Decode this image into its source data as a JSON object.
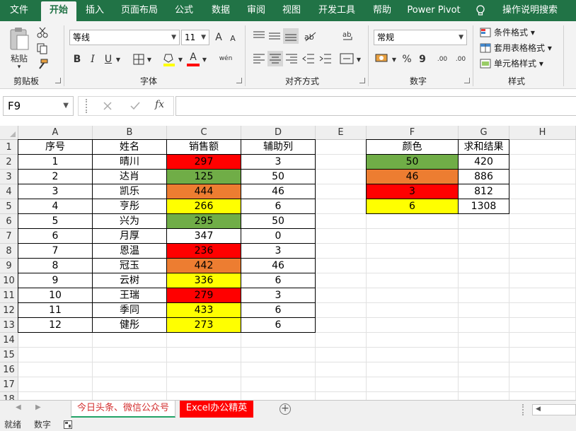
{
  "tabs": [
    "文件",
    "开始",
    "插入",
    "页面布局",
    "公式",
    "数据",
    "审阅",
    "视图",
    "开发工具",
    "帮助",
    "Power Pivot",
    "操作说明搜索"
  ],
  "active_tab": "开始",
  "ribbon": {
    "clipboard": {
      "paste_label": "粘贴",
      "group_label": "剪贴板"
    },
    "font": {
      "font_name": "等线",
      "font_size": "11",
      "increase_label": "A",
      "decrease_label": "A",
      "wen_label": "wén",
      "group_label": "字体"
    },
    "alignment": {
      "group_label": "对齐方式"
    },
    "number": {
      "format": "常规",
      "percent": "%",
      "comma": "9",
      "inc_dec": ".00",
      "group_label": "数字"
    },
    "styles": {
      "conditional": "条件格式",
      "table": "套用表格格式",
      "cell": "单元格样式",
      "group_label": "样式"
    }
  },
  "formula_bar": {
    "name_box": "F9",
    "fx": "fx",
    "content": ""
  },
  "columns": [
    "A",
    "B",
    "C",
    "D",
    "E",
    "F",
    "G",
    "H"
  ],
  "rows": [
    "1",
    "2",
    "3",
    "4",
    "5",
    "6",
    "7",
    "8",
    "9",
    "10",
    "11",
    "12",
    "13",
    "14",
    "15",
    "16",
    "17",
    "18"
  ],
  "table1": {
    "headers": [
      "序号",
      "姓名",
      "销售额",
      "辅助列"
    ],
    "rows": [
      [
        "1",
        "晴川",
        "297",
        "3"
      ],
      [
        "2",
        "达肖",
        "125",
        "50"
      ],
      [
        "3",
        "凯乐",
        "444",
        "46"
      ],
      [
        "4",
        "亨彤",
        "266",
        "6"
      ],
      [
        "5",
        "兴为",
        "295",
        "50"
      ],
      [
        "6",
        "月厚",
        "347",
        "0"
      ],
      [
        "7",
        "恩温",
        "236",
        "3"
      ],
      [
        "8",
        "冠玉",
        "442",
        "46"
      ],
      [
        "9",
        "云树",
        "336",
        "6"
      ],
      [
        "10",
        "王瑞",
        "279",
        "3"
      ],
      [
        "11",
        "季同",
        "433",
        "6"
      ],
      [
        "12",
        "健彤",
        "273",
        "6"
      ]
    ],
    "sales_colors": [
      "#ff0000",
      "#70ad47",
      "#ed7d31",
      "#ffff00",
      "#70ad47",
      "#ffffff",
      "#ff0000",
      "#ed7d31",
      "#ffff00",
      "#ff0000",
      "#ffff00",
      "#ffff00"
    ]
  },
  "table2": {
    "headers": [
      "颜色",
      "求和结果"
    ],
    "rows": [
      [
        "50",
        "420"
      ],
      [
        "46",
        "886"
      ],
      [
        "3",
        "812"
      ],
      [
        "6",
        "1308"
      ]
    ],
    "colors": [
      "#70ad47",
      "#ed7d31",
      "#ff0000",
      "#ffff00"
    ]
  },
  "sheet_tabs": [
    "今日头条、微信公众号",
    "Excel办公精英"
  ],
  "status": {
    "mode": "就绪",
    "num": "数字"
  }
}
